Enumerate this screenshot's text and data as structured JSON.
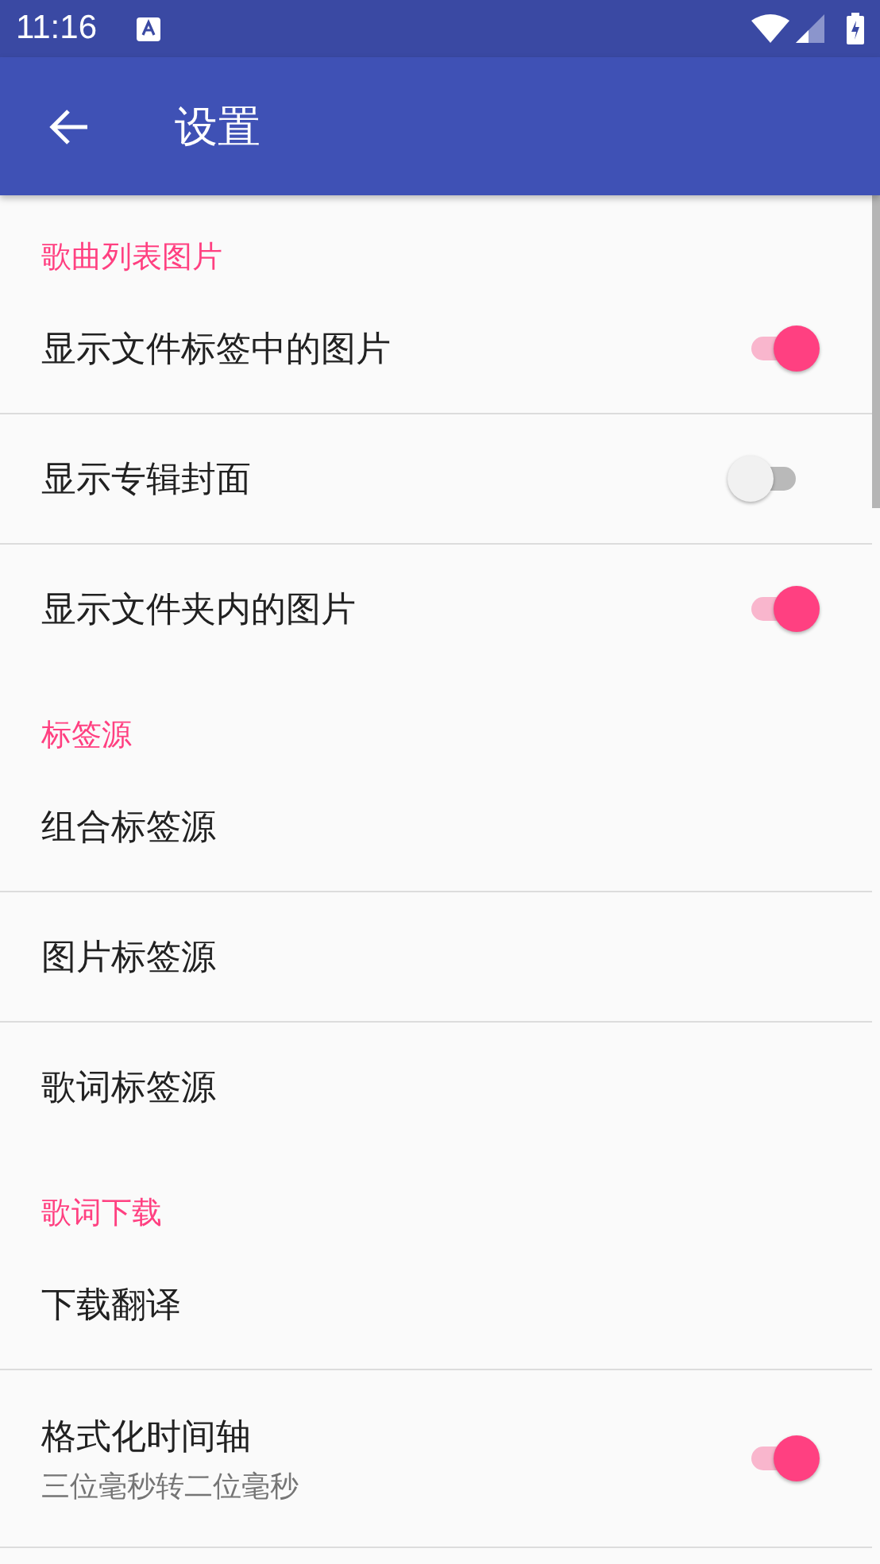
{
  "status_bar": {
    "time": "11:16"
  },
  "app_bar": {
    "title": "设置"
  },
  "sections": [
    {
      "title": "歌曲列表图片",
      "items": [
        {
          "kind": "switch",
          "label": "显示文件标签中的图片",
          "on": true
        },
        {
          "kind": "switch",
          "label": "显示专辑封面",
          "on": false
        },
        {
          "kind": "switch",
          "label": "显示文件夹内的图片",
          "on": true
        }
      ]
    },
    {
      "title": "标签源",
      "items": [
        {
          "kind": "plain",
          "label": "组合标签源"
        },
        {
          "kind": "plain",
          "label": "图片标签源"
        },
        {
          "kind": "plain",
          "label": "歌词标签源"
        }
      ]
    },
    {
      "title": "歌词下载",
      "items": [
        {
          "kind": "plain",
          "label": "下载翻译"
        },
        {
          "kind": "switch",
          "label": "格式化时间轴",
          "summary": "三位毫秒转二位毫秒",
          "on": true
        }
      ]
    }
  ]
}
